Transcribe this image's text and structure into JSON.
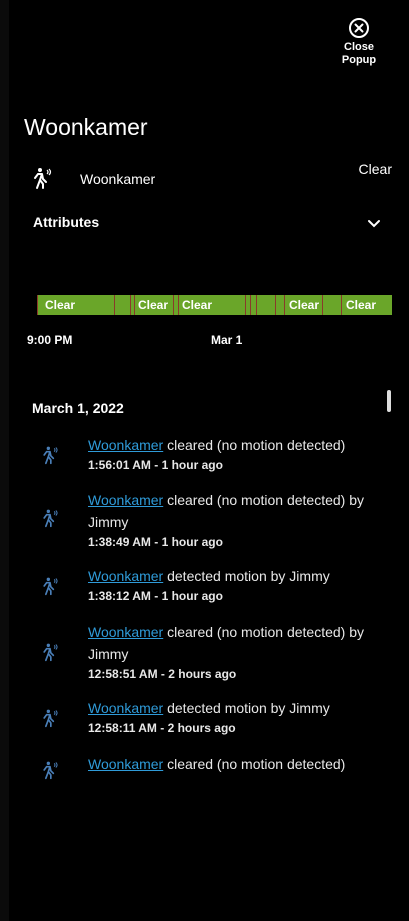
{
  "close_popup": {
    "line1": "Close",
    "line2": "Popup"
  },
  "title": "Woonkamer",
  "entity": {
    "name": "Woonkamer",
    "state": "Clear"
  },
  "attributes_label": "Attributes",
  "timeline": {
    "labels": [
      "Clear",
      "Clear",
      "Clear",
      "Clear",
      "Clear"
    ],
    "axis": [
      "9:00 PM",
      "Mar 1"
    ],
    "colors": {
      "clear": "#6aa629",
      "detected": "#8a3a2a"
    }
  },
  "logbook": {
    "date": "March 1, 2022",
    "entries": [
      {
        "link": "Woonkamer",
        "text": " cleared (no motion detected)",
        "time": "1:56:01 AM - 1 hour ago"
      },
      {
        "link": "Woonkamer",
        "text": " cleared (no motion detected) by Jimmy",
        "time": "1:38:49 AM - 1 hour ago"
      },
      {
        "link": "Woonkamer",
        "text": " detected motion by Jimmy",
        "time": "1:38:12 AM - 1 hour ago"
      },
      {
        "link": "Woonkamer",
        "text": " cleared (no motion detected) by Jimmy",
        "time": "12:58:51 AM - 2 hours ago"
      },
      {
        "link": "Woonkamer",
        "text": " detected motion by Jimmy",
        "time": "12:58:11 AM - 2 hours ago"
      },
      {
        "link": "Woonkamer",
        "text": " cleared (no motion detected)",
        "time": ""
      }
    ]
  },
  "icons": {
    "close": "close-circle-icon",
    "motion": "motion-sensor-icon",
    "chevron": "chevron-down-icon"
  },
  "colors": {
    "link": "#2f9bd9",
    "background": "#000000"
  }
}
